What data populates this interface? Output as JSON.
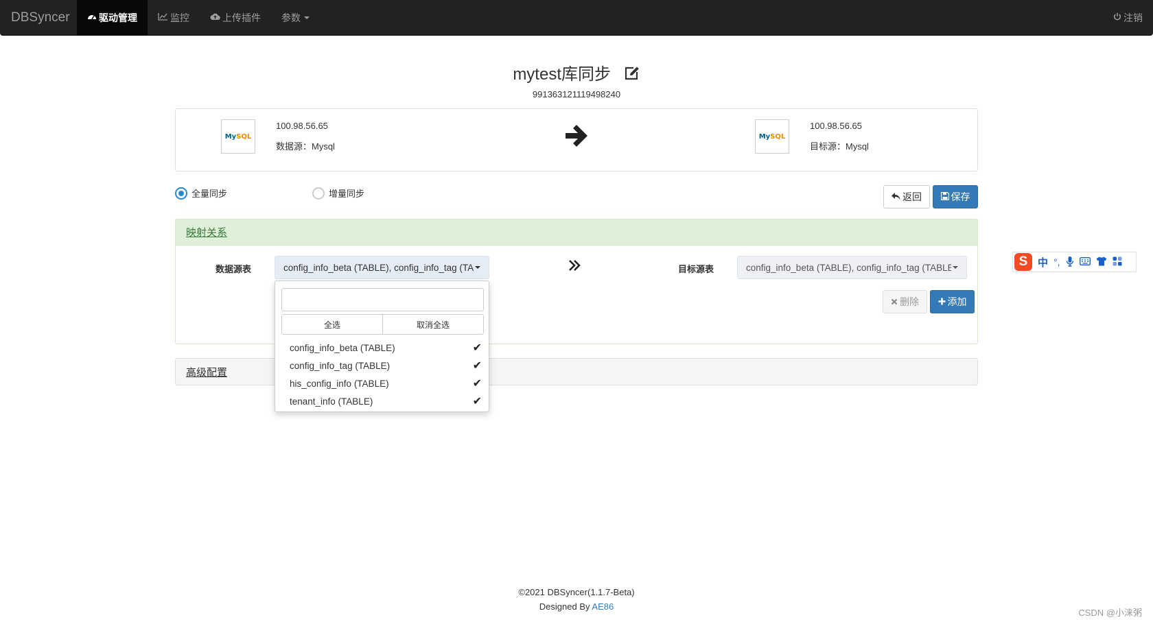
{
  "navbar": {
    "brand": "DBSyncer",
    "items": [
      {
        "label": "驱动管理",
        "icon": "dashboard-icon"
      },
      {
        "label": "监控",
        "icon": "chart-line-icon"
      },
      {
        "label": "上传插件",
        "icon": "cloud-upload-icon"
      },
      {
        "label": "参数",
        "icon": "caret-down-icon"
      }
    ],
    "logout_label": "注销"
  },
  "header": {
    "title": "mytest库同步",
    "id": "991363121119498240"
  },
  "source": {
    "host": "100.98.56.65",
    "type_text": "数据源：Mysql",
    "logo_my": "My",
    "logo_sql": "SQL"
  },
  "target": {
    "host": "100.98.56.65",
    "type_text": "目标源：Mysql",
    "logo_my": "My",
    "logo_sql": "SQL"
  },
  "sync_mode": {
    "full_label": "全量同步",
    "incremental_label": "增量同步",
    "selected": "全量同步"
  },
  "actions": {
    "back_label": "返回",
    "save_label": "保存"
  },
  "mapping": {
    "heading": "映射关系",
    "source_label": "数据源表",
    "source_selected": "config_info_beta (TABLE), config_info_tag (TABLE), his_config_info (TABLE), tenant_info (TABLE)",
    "target_label": "目标源表",
    "target_selected": "config_info_beta (TABLE), config_info_tag (TABLE), his_config_info (TABLE), tenant_info (TABLE)",
    "delete_label": "删除",
    "add_label": "添加"
  },
  "dropdown": {
    "search_value": "",
    "select_all_label": "全选",
    "deselect_all_label": "取消全选",
    "options": [
      {
        "label": "config_info_beta (TABLE)",
        "checked": true
      },
      {
        "label": "config_info_tag (TABLE)",
        "checked": true
      },
      {
        "label": "his_config_info (TABLE)",
        "checked": true
      },
      {
        "label": "tenant_info (TABLE)",
        "checked": true
      }
    ]
  },
  "advanced": {
    "heading": "高级配置"
  },
  "ime": {
    "logo": "S",
    "mode": "中",
    "punct": "°,"
  },
  "footer": {
    "copyright": "©2021 DBSyncer(1.1.7-Beta)",
    "designed_by": "Designed By",
    "author": "AE86"
  },
  "watermark": "CSDN @小涞粥",
  "colors": {
    "navbar_bg": "#222222",
    "primary": "#337ab7",
    "success_bg": "#dff0d8",
    "radio_active": "#2a88c8"
  }
}
